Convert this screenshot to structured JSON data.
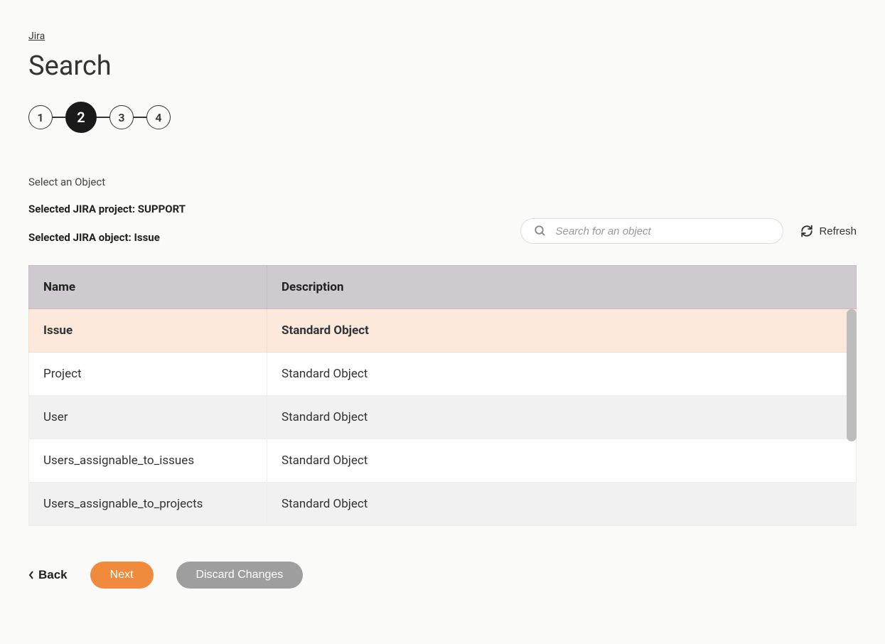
{
  "breadcrumb": "Jira",
  "pageTitle": "Search",
  "steps": [
    "1",
    "2",
    "3",
    "4"
  ],
  "activeStep": 1,
  "subtitle": "Select an Object",
  "selectedProjectLabel": "Selected JIRA project: SUPPORT",
  "selectedObjectLabel": "Selected JIRA object: Issue",
  "search": {
    "placeholder": "Search for an object"
  },
  "refreshLabel": "Refresh",
  "table": {
    "headers": {
      "name": "Name",
      "description": "Description"
    },
    "rows": [
      {
        "name": "Issue",
        "description": "Standard Object",
        "selected": true
      },
      {
        "name": "Project",
        "description": "Standard Object",
        "selected": false
      },
      {
        "name": "User",
        "description": "Standard Object",
        "selected": false
      },
      {
        "name": "Users_assignable_to_issues",
        "description": "Standard Object",
        "selected": false
      },
      {
        "name": "Users_assignable_to_projects",
        "description": "Standard Object",
        "selected": false
      }
    ]
  },
  "buttons": {
    "back": "Back",
    "next": "Next",
    "discard": "Discard Changes"
  }
}
